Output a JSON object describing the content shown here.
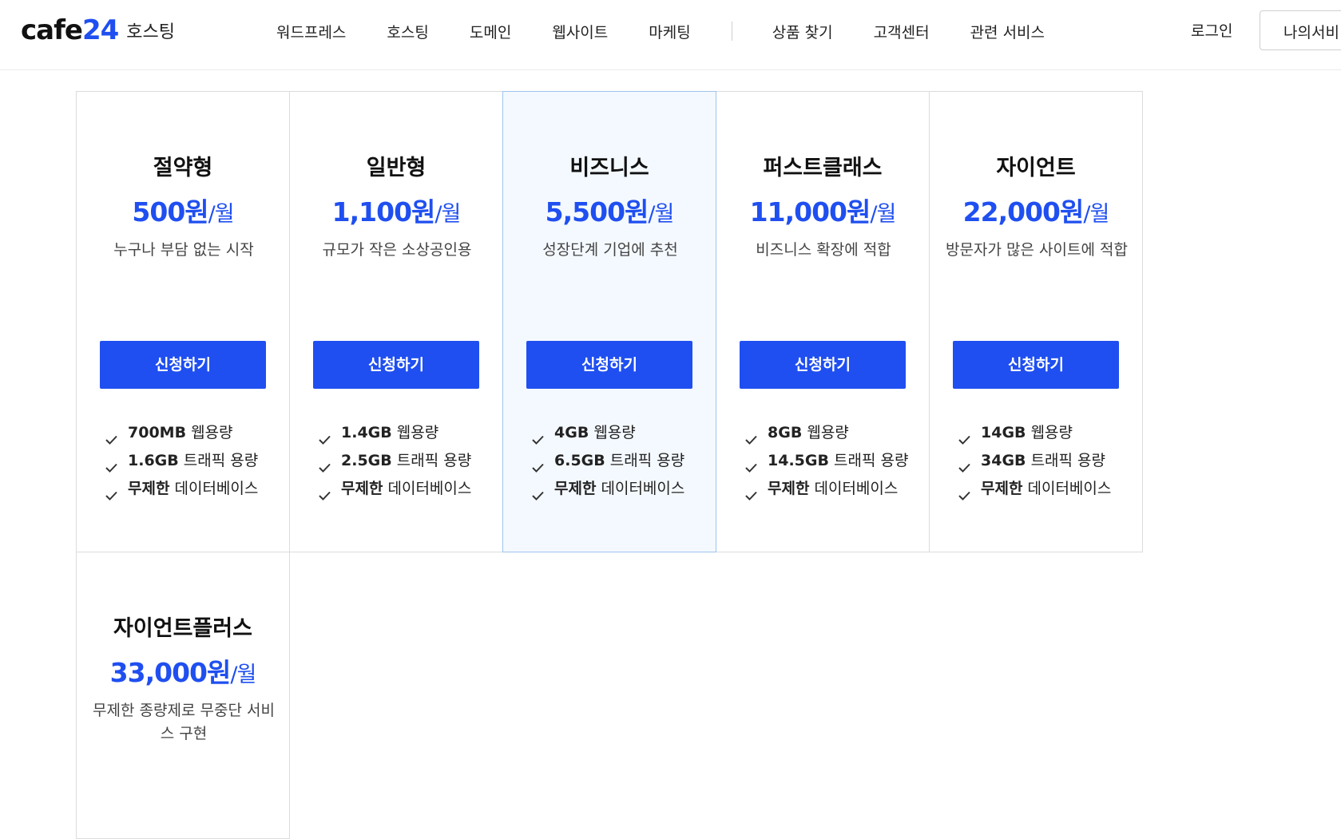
{
  "header": {
    "logo_mark": "cafe",
    "logo_num": "24",
    "logo_sub": "호스팅",
    "nav_left": [
      "워드프레스",
      "호스팅",
      "도메인",
      "웹사이트",
      "마케팅"
    ],
    "nav_right": [
      "상품 찾기",
      "고객센터",
      "관련 서비스"
    ],
    "login": "로그인",
    "my_button": "나의서비"
  },
  "plans": [
    {
      "name": "절약형",
      "price": "500원",
      "unit": "/월",
      "desc": "누구나 부담 없는 시작",
      "button": "신청하기",
      "features": [
        {
          "strong": "700MB",
          "rest": " 웹용량"
        },
        {
          "strong": "1.6GB",
          "rest": " 트래픽 용량"
        },
        {
          "strong": "무제한",
          "rest": " 데이터베이스"
        }
      ]
    },
    {
      "name": "일반형",
      "price": "1,100원",
      "unit": "/월",
      "desc": "규모가 작은 소상공인용",
      "button": "신청하기",
      "features": [
        {
          "strong": "1.4GB",
          "rest": " 웹용량"
        },
        {
          "strong": "2.5GB",
          "rest": " 트래픽 용량"
        },
        {
          "strong": "무제한",
          "rest": " 데이터베이스"
        }
      ]
    },
    {
      "name": "비즈니스",
      "price": "5,500원",
      "unit": "/월",
      "desc": "성장단계 기업에 추천",
      "button": "신청하기",
      "features": [
        {
          "strong": "4GB",
          "rest": " 웹용량"
        },
        {
          "strong": "6.5GB",
          "rest": " 트래픽 용량"
        },
        {
          "strong": "무제한",
          "rest": " 데이터베이스"
        }
      ]
    },
    {
      "name": "퍼스트클래스",
      "price": "11,000원",
      "unit": "/월",
      "desc": "비즈니스 확장에 적합",
      "button": "신청하기",
      "features": [
        {
          "strong": "8GB",
          "rest": " 웹용량"
        },
        {
          "strong": "14.5GB",
          "rest": " 트래픽 용량"
        },
        {
          "strong": "무제한",
          "rest": " 데이터베이스"
        }
      ]
    },
    {
      "name": "자이언트",
      "price": "22,000원",
      "unit": "/월",
      "desc": "방문자가 많은 사이트에 적합",
      "button": "신청하기",
      "features": [
        {
          "strong": "14GB",
          "rest": " 웹용량"
        },
        {
          "strong": "34GB",
          "rest": " 트래픽 용량"
        },
        {
          "strong": "무제한",
          "rest": " 데이터베이스"
        }
      ]
    },
    {
      "name": "자이언트플러스",
      "price": "33,000원",
      "unit": "/월",
      "desc": "무제한 종량제로 무중단 서비스 구현",
      "button": "신청하기",
      "features": []
    }
  ],
  "colors": {
    "accent": "#1f4ff0",
    "featured_bg": "#f4f9ff",
    "featured_border": "#9ec3ee"
  }
}
